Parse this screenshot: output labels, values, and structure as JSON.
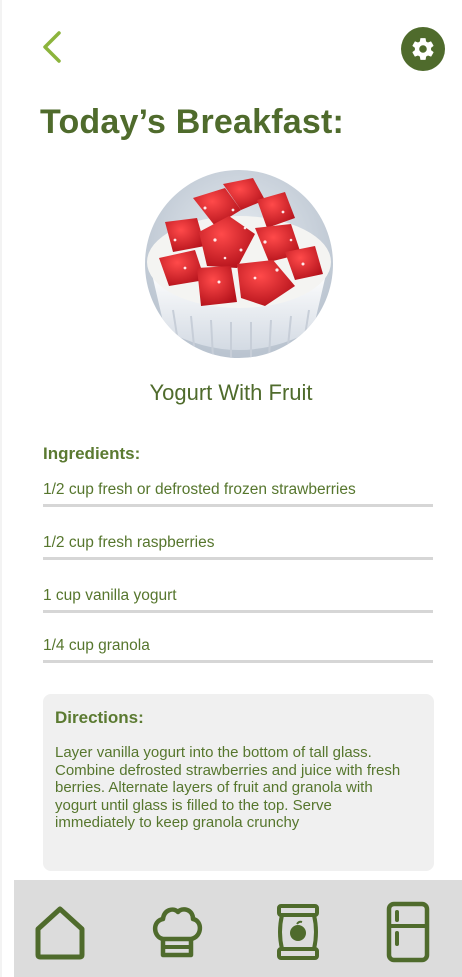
{
  "header": {
    "back_icon": "chevron-left-icon",
    "settings_icon": "gear-icon"
  },
  "title": "Today’s Breakfast:",
  "dish": {
    "image": "yogurt-with-strawberries-photo",
    "name": "Yogurt With Fruit"
  },
  "ingredients": {
    "heading": "Ingredients:",
    "items": [
      "1/2 cup fresh or defrosted frozen strawberries",
      "1/2 cup fresh raspberries",
      "1 cup vanilla yogurt",
      "1/4 cup granola"
    ]
  },
  "directions": {
    "heading": "Directions:",
    "text": "Layer vanilla yogurt into the bottom of tall glass. Combine defrosted strawberries and juice with fresh berries. Alternate layers of fruit and granola with yogurt until glass is filled to the top. Serve  immediately to keep granola crunchy"
  },
  "nav": {
    "items": [
      "home-icon",
      "chef-hat-icon",
      "pantry-jar-icon",
      "fridge-icon"
    ]
  },
  "colors": {
    "primary": "#4f6b2c",
    "divider": "#d6d6d6",
    "panel": "#f0f0f0",
    "navbar": "#dcdcdc"
  }
}
